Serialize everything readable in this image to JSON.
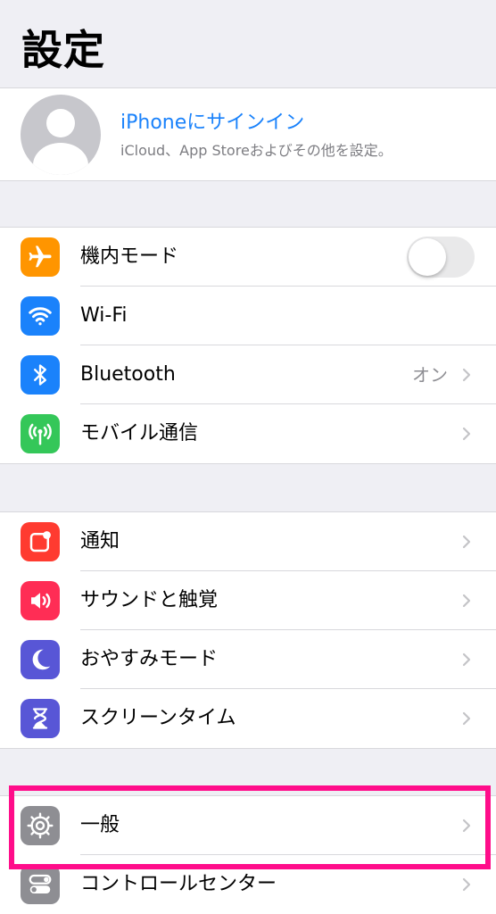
{
  "header": {
    "title": "設定"
  },
  "profile": {
    "title": "iPhoneにサインイン",
    "subtitle": "iCloud、App Storeおよびその他を設定。"
  },
  "group1": [
    {
      "label": "機内モード",
      "icon": "airplane-icon",
      "color": "#ff9500",
      "control": "toggle",
      "toggle_on": false
    },
    {
      "label": "Wi-Fi",
      "icon": "wifi-icon",
      "color": "#1a82fb",
      "control": "none"
    },
    {
      "label": "Bluetooth",
      "icon": "bluetooth-icon",
      "color": "#1a82fb",
      "value": "オン",
      "control": "chevron"
    },
    {
      "label": "モバイル通信",
      "icon": "antenna-icon",
      "color": "#34c759",
      "control": "chevron"
    }
  ],
  "group2": [
    {
      "label": "通知",
      "icon": "notifications-icon",
      "color": "#ff3b30"
    },
    {
      "label": "サウンドと触覚",
      "icon": "speaker-icon",
      "color": "#ff2d55"
    },
    {
      "label": "おやすみモード",
      "icon": "moon-icon",
      "color": "#5856d6"
    },
    {
      "label": "スクリーンタイム",
      "icon": "hourglass-icon",
      "color": "#5856d6"
    }
  ],
  "group3": [
    {
      "label": "一般",
      "icon": "gear-icon",
      "color": "#8e8e93"
    },
    {
      "label": "コントロールセンター",
      "icon": "control-center-icon",
      "color": "#8e8e93"
    }
  ],
  "highlight_color": "#ff0d8a"
}
